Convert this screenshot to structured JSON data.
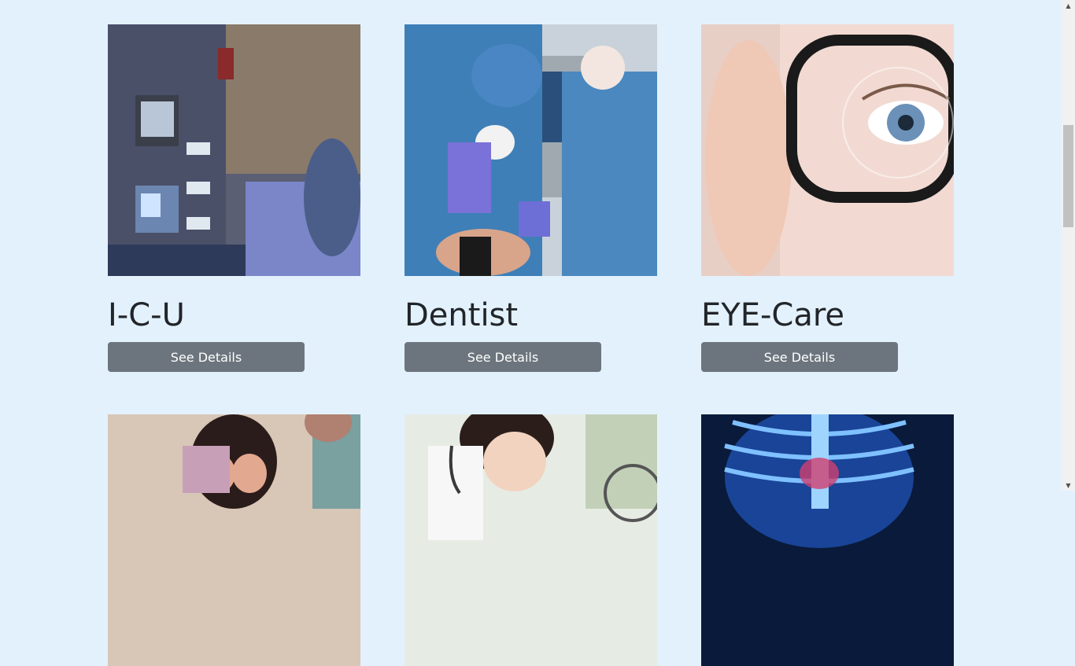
{
  "services": [
    {
      "title": "I-C-U",
      "button": "See Details",
      "image": "icu-equipment-photo"
    },
    {
      "title": "Dentist",
      "button": "See Details",
      "image": "dentist-surgery-photo"
    },
    {
      "title": "EYE-Care",
      "button": "See Details",
      "image": "eye-glasses-photo"
    }
  ],
  "next_row_images": [
    "distressed-woman-photo",
    "female-doctor-photo",
    "skeleton-xray-photo"
  ],
  "scrollbar": {
    "up_icon": "▲",
    "down_icon": "▼"
  }
}
